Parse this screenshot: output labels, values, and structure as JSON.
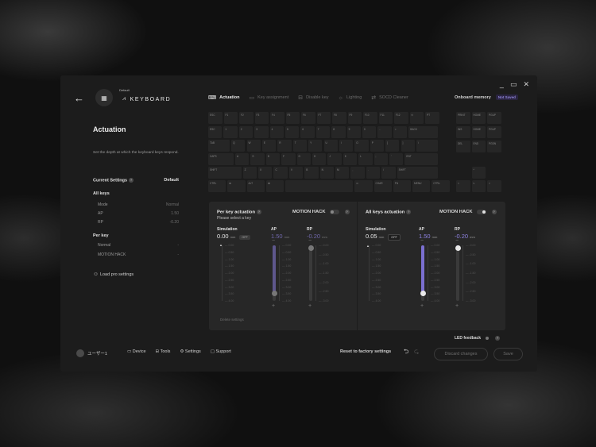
{
  "window": {
    "controls": [
      "_",
      "▭",
      "✕"
    ]
  },
  "header": {
    "back": "←",
    "profile_label": "Default",
    "keyboard_name": "KEYBOARD",
    "tabs": [
      {
        "label": "Actuation",
        "icon": "⌨"
      },
      {
        "label": "Key assignment",
        "icon": "▭"
      },
      {
        "label": "Disable key",
        "icon": "⊟"
      },
      {
        "label": "Lighting",
        "icon": "☼"
      },
      {
        "label": "SOCD Cleaner",
        "icon": "⇄"
      }
    ],
    "onboard_label": "Onboard memory",
    "onboard_status": "Not Saved"
  },
  "left": {
    "title": "Actuation",
    "description": "Set the depth at which the keyboard keys respond.",
    "current_settings": "Current Settings",
    "profile": "Default",
    "all_keys": "All keys",
    "all_rows": [
      {
        "label": "Mode",
        "value": "Normal"
      },
      {
        "label": "AP",
        "value": "1.50"
      },
      {
        "label": "RP",
        "value": "-0.20"
      }
    ],
    "per_key": "Per key",
    "per_rows": [
      {
        "label": "Normal",
        "value": "-"
      },
      {
        "label": "MOTION HACK",
        "value": "-"
      }
    ],
    "load_pro": "Load pro settings"
  },
  "keyboard": {
    "rows": [
      [
        "ESC",
        "F1",
        "F2",
        "F3",
        "F4",
        "F5",
        "F6",
        "F7",
        "F8",
        "F9",
        "F10",
        "F11",
        "F12",
        "⏻",
        "PT"
      ],
      [
        "ESC",
        "1",
        "2",
        "3",
        "4",
        "5",
        "6",
        "7",
        "8",
        "9",
        "0",
        "-",
        "=",
        "BACK"
      ],
      [
        "TAB",
        "Q",
        "W",
        "E",
        "R",
        "T",
        "Y",
        "U",
        "I",
        "O",
        "P",
        "[",
        "]",
        "\\"
      ],
      [
        "CAPS",
        "A",
        "S",
        "D",
        "F",
        "G",
        "H",
        "J",
        "K",
        "L",
        ";",
        "'",
        "ENT"
      ],
      [
        "SHIFT",
        "Z",
        "X",
        "C",
        "V",
        "B",
        "N",
        "M",
        ",",
        ".",
        "/",
        "SHIFT"
      ],
      [
        "CTRL",
        "⊞",
        "ALT",
        "⌘",
        "",
        "⊙",
        "CHAR",
        "FN",
        "MENU",
        "CTRL"
      ]
    ],
    "nav": [
      "PRINT",
      "HOME",
      "PGUP",
      "INS",
      "HOME",
      "PGUP",
      "DEL",
      "END",
      "PGDN"
    ],
    "arrows": [
      "^",
      "<",
      "v",
      ">"
    ]
  },
  "per_key_panel": {
    "title": "Per key actuation",
    "subtitle": "Please select a key",
    "motion_hack": "MOTION HACK",
    "simulation": "Simulation",
    "sim_value": "0.00",
    "sim_unit": "mm",
    "sim_state": "OFF",
    "ap_label": "AP",
    "ap_value": "1.50",
    "rp_label": "RP",
    "rp_value": "-0.20",
    "unit": "mm",
    "delete": "Delete settings",
    "ticks_sim": [
      "0.00",
      "0.50",
      "1.00",
      "1.50",
      "2.00",
      "2.50",
      "3.00",
      "3.50",
      "4.00"
    ],
    "ticks_ap": [
      "0.00",
      "0.50",
      "1.00",
      "1.50",
      "2.00",
      "2.50",
      "3.00",
      "3.50",
      "4.00"
    ],
    "ticks_rp": [
      "-0.00",
      "-0.50",
      "-1.00",
      "-1.50",
      "-2.00",
      "-2.50",
      "-3.00"
    ]
  },
  "all_keys_panel": {
    "title": "All keys actuation",
    "motion_hack": "MOTION HACK",
    "simulation": "Simulation",
    "sim_value": "0.05",
    "sim_unit": "mm",
    "sim_state": "OFF",
    "ap_label": "AP",
    "ap_value": "1.50",
    "rp_label": "RP",
    "rp_value": "-0.20",
    "unit": "mm",
    "ticks_sim": [
      "0.00",
      "0.50",
      "1.00",
      "1.50",
      "2.00",
      "2.50",
      "3.00",
      "3.50",
      "4.00"
    ],
    "ticks_ap": [
      "0.00",
      "0.50",
      "1.00",
      "1.50",
      "2.00",
      "2.50",
      "3.00",
      "3.50",
      "4.00"
    ],
    "ticks_rp": [
      "-0.00",
      "-0.50",
      "-1.00",
      "-1.50",
      "-2.00",
      "-2.50",
      "-3.00"
    ]
  },
  "footer": {
    "led": "LED feedback",
    "user": "ユーザー1",
    "nav": [
      {
        "label": "Device",
        "icon": "▭"
      },
      {
        "label": "Tools",
        "icon": "⊟"
      },
      {
        "label": "Settings",
        "icon": "⚙"
      },
      {
        "label": "Support",
        "icon": "▢"
      }
    ],
    "reset": "Reset to factory settings",
    "undo": "⮌",
    "redo": "⮎",
    "discard": "Discard changes",
    "save": "Save"
  }
}
